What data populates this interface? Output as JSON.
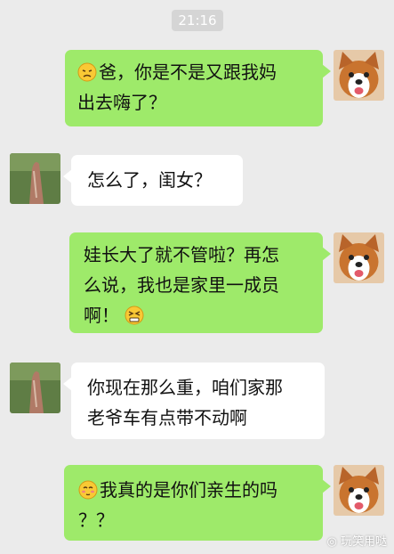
{
  "timestamp": "21:16",
  "messages": [
    {
      "side": "right",
      "emoji_before": "pensive-emoji",
      "lines": [
        "爸，你是不是又跟我妈",
        "出去嗨了？"
      ]
    },
    {
      "side": "left",
      "lines": [
        "怎么了，闺女？"
      ]
    },
    {
      "side": "right",
      "emoji_after": "grimace-emoji",
      "lines": [
        "娃长大了就不管啦？再怎",
        "么说，我也是家里一成员",
        "啊！"
      ]
    },
    {
      "side": "left",
      "lines": [
        "你现在那么重，咱们家那",
        "老爷车有点带不动啊"
      ]
    },
    {
      "side": "right",
      "emoji_before": "blushing-emoji",
      "lines": [
        "我真的是你们亲生的吗",
        "？？"
      ]
    }
  ],
  "watermark": "玩笑用哒",
  "colors": {
    "background": "#ebebeb",
    "right_bubble": "#9eea6a",
    "left_bubble": "#ffffff"
  }
}
